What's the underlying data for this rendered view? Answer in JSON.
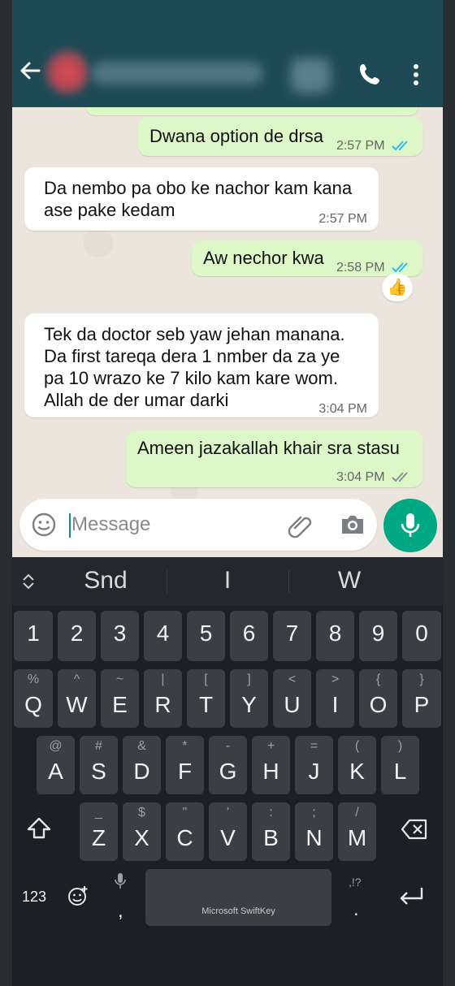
{
  "header": {
    "back_icon": "arrow-left-icon",
    "call_icon": "phone-icon",
    "more_icon": "kebab-menu-icon"
  },
  "messages": [
    {
      "dir": "out",
      "text": "Dwana option de drsa",
      "time": "2:57 PM",
      "status": "read"
    },
    {
      "dir": "in",
      "text": "Da nembo pa obo ke nachor kam kana\nase pake kedam",
      "time": "2:57 PM"
    },
    {
      "dir": "out",
      "text": "Aw nechor kwa",
      "time": "2:58 PM",
      "status": "read",
      "reaction": "👍"
    },
    {
      "dir": "in",
      "text": "Tek da doctor seb yaw jehan manana.\nDa first tareqa dera 1 nmber da za ye\npa 10 wrazo ke 7 kilo kam kare wom.\nAllah de der umar darki",
      "time": "3:04 PM"
    },
    {
      "dir": "out",
      "text": "Ameen jazakallah khair sra stasu",
      "time": "3:04 PM",
      "status": "delivered"
    }
  ],
  "composer": {
    "placeholder": "Message",
    "emoji_icon": "emoji-icon",
    "attach_icon": "paperclip-icon",
    "camera_icon": "camera-icon",
    "mic_icon": "microphone-icon"
  },
  "keyboard": {
    "brand": "Microsoft SwiftKey",
    "suggestions": [
      "Snd",
      "I",
      "W"
    ],
    "number_row": [
      "1",
      "2",
      "3",
      "4",
      "5",
      "6",
      "7",
      "8",
      "9",
      "0"
    ],
    "row1": [
      {
        "k": "Q",
        "s": "%"
      },
      {
        "k": "W",
        "s": "^"
      },
      {
        "k": "E",
        "s": "~"
      },
      {
        "k": "R",
        "s": "|"
      },
      {
        "k": "T",
        "s": "["
      },
      {
        "k": "Y",
        "s": "]"
      },
      {
        "k": "U",
        "s": "<"
      },
      {
        "k": "I",
        "s": ">"
      },
      {
        "k": "O",
        "s": "{"
      },
      {
        "k": "P",
        "s": "}"
      }
    ],
    "row2": [
      {
        "k": "A",
        "s": "@"
      },
      {
        "k": "S",
        "s": "#"
      },
      {
        "k": "D",
        "s": "&"
      },
      {
        "k": "F",
        "s": "*"
      },
      {
        "k": "G",
        "s": "-"
      },
      {
        "k": "H",
        "s": "+"
      },
      {
        "k": "J",
        "s": "="
      },
      {
        "k": "K",
        "s": "("
      },
      {
        "k": "L",
        "s": ")"
      }
    ],
    "row3": [
      {
        "k": "Z",
        "s": "_"
      },
      {
        "k": "X",
        "s": "$"
      },
      {
        "k": "C",
        "s": "\""
      },
      {
        "k": "V",
        "s": "'"
      },
      {
        "k": "B",
        "s": ":"
      },
      {
        "k": "N",
        "s": ";"
      },
      {
        "k": "M",
        "s": "/"
      }
    ],
    "label_123": "123",
    "comma": ",",
    "period": ".",
    "punct_hint": ",!?",
    "colors": {
      "key": "#3b3e43",
      "accent": "#00a884",
      "out_bubble": "#dcf8c6",
      "read_ticks": "#34b7f1"
    }
  }
}
